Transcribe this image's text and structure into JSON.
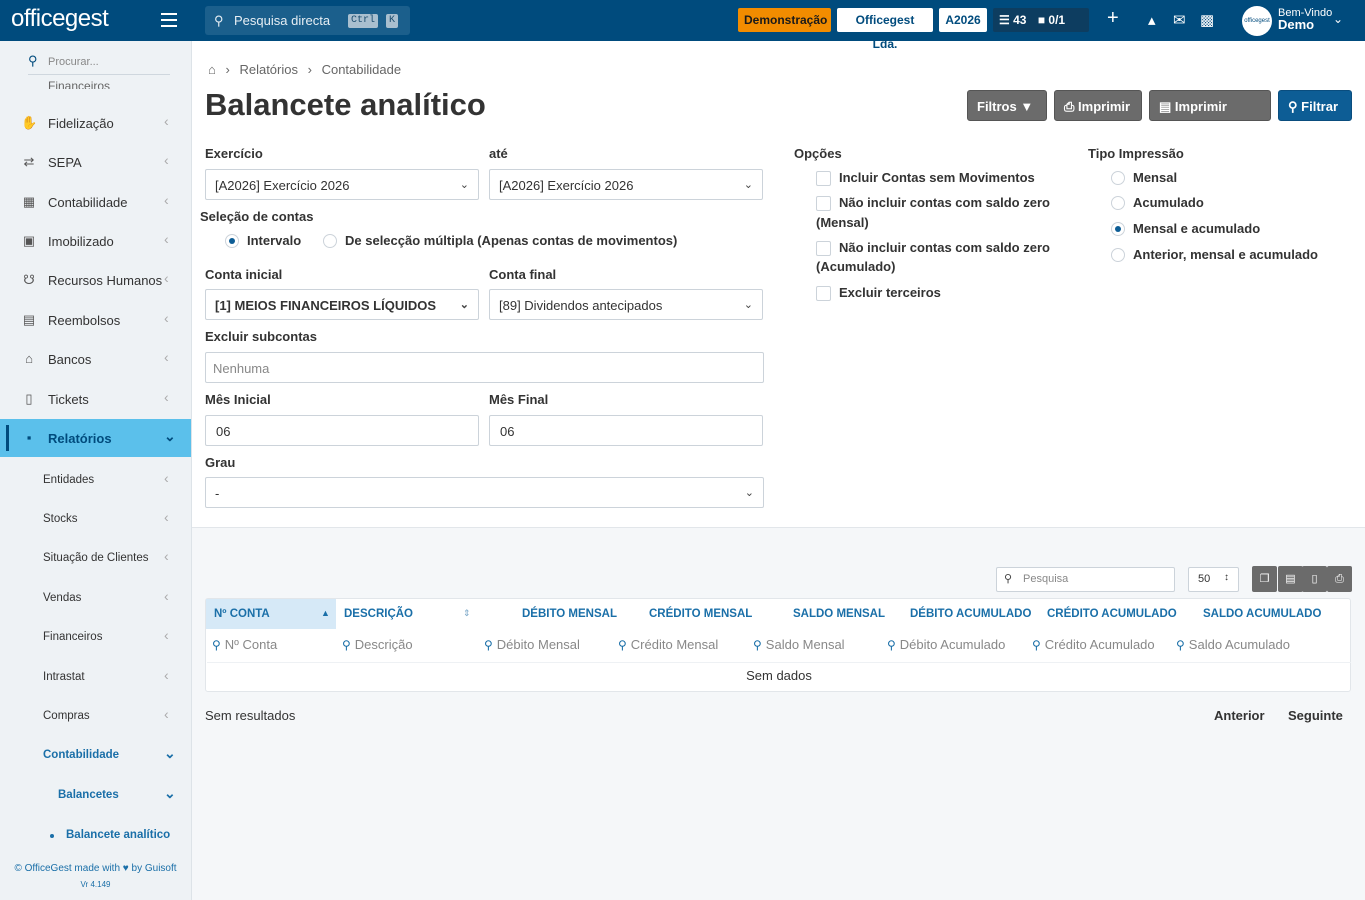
{
  "topbar": {
    "logo": "officegest",
    "search_placeholder": "Pesquisa directa",
    "kbd_ctrl": "Ctrl",
    "kbd_k": "K",
    "demo_badge": "Demonstração",
    "company_badge": "Officegest Lda.",
    "year_badge": "A2026",
    "tasks_count": "43",
    "docs_count": "0/1",
    "welcome": "Bem-Vindo",
    "user": "Demo",
    "avatar_text": "officegest",
    "colors": {
      "bar": "#004b7d",
      "demo": "#f28c00"
    }
  },
  "sidebar": {
    "search_placeholder": "Procurar...",
    "cut_item": "Financeiros",
    "items": [
      {
        "label": "Fidelização",
        "icon": "hand-coin-icon"
      },
      {
        "label": "SEPA",
        "icon": "arrows-swap-icon"
      },
      {
        "label": "Contabilidade",
        "icon": "calculator-icon"
      },
      {
        "label": "Imobilizado",
        "icon": "boxes-icon"
      },
      {
        "label": "Recursos Humanos",
        "icon": "org-chart-icon"
      },
      {
        "label": "Reembolsos",
        "icon": "money-icon"
      },
      {
        "label": "Bancos",
        "icon": "bank-icon"
      },
      {
        "label": "Tickets",
        "icon": "ticket-icon"
      },
      {
        "label": "Relatórios",
        "icon": "chart-icon"
      }
    ],
    "sub_items": [
      {
        "label": "Entidades"
      },
      {
        "label": "Stocks"
      },
      {
        "label": "Situação de Clientes"
      },
      {
        "label": "Vendas"
      },
      {
        "label": "Financeiros"
      },
      {
        "label": "Intrastat"
      },
      {
        "label": "Compras"
      },
      {
        "label": "Contabilidade"
      },
      {
        "label": "Balancetes"
      },
      {
        "label": "Balancete analítico"
      }
    ],
    "footer_a": "© OfficeGest made with",
    "footer_b": "by Guisoft",
    "version": "Vr 4.149",
    "active_color": "#5bc0eb"
  },
  "page": {
    "breadcrumb": [
      "Relatórios",
      "Contabilidade"
    ],
    "title": "Balancete analítico",
    "buttons": {
      "filters": "Filtros",
      "print": "Imprimir",
      "print_excel": "Imprimir Excel",
      "filter": "Filtrar"
    }
  },
  "form": {
    "exercicio_label": "Exercício",
    "exercicio_value": "[A2026] Exercício 2026",
    "ate_label": "até",
    "ate_value": "[A2026] Exercício 2026",
    "selecao_label": "Seleção de contas",
    "radio_intervalo": "Intervalo",
    "radio_multipla": "De selecção múltipla (Apenas contas de movimentos)",
    "conta_inicial_label": "Conta inicial",
    "conta_inicial_value": "[1] MEIOS FINANCEIROS LÍQUIDOS",
    "conta_final_label": "Conta final",
    "conta_final_value": "[89] Dividendos antecipados",
    "excluir_label": "Excluir subcontas",
    "excluir_placeholder": "Nenhuma",
    "mes_inicial_label": "Mês Inicial",
    "mes_inicial_value": "06",
    "mes_final_label": "Mês Final",
    "mes_final_value": "06",
    "grau_label": "Grau",
    "grau_value": "-",
    "opcoes_label": "Opções",
    "opt1": "Incluir Contas sem Movimentos",
    "opt2a": "Não incluir contas com saldo zero",
    "opt2b": "(Mensal)",
    "opt3a": "Não incluir contas com saldo zero",
    "opt3b": "(Acumulado)",
    "opt4": "Excluir terceiros",
    "tipo_label": "Tipo Impressão",
    "tipo1": "Mensal",
    "tipo2": "Acumulado",
    "tipo3": "Mensal e acumulado",
    "tipo4": "Anterior, mensal e acumulado"
  },
  "grid": {
    "search_placeholder": "Pesquisa",
    "page_size": "50",
    "columns": [
      "Nº CONTA",
      "DESCRIÇÃO",
      "DÉBITO MENSAL",
      "CRÉDITO MENSAL",
      "SALDO MENSAL",
      "DÉBITO ACUMULADO",
      "CRÉDITO ACUMULADO",
      "SALDO ACUMULADO"
    ],
    "filters": [
      "Nº Conta",
      "Descrição",
      "Débito Mensal",
      "Crédito Mensal",
      "Saldo Mensal",
      "Débito Acumulado",
      "Crédito Acumulado",
      "Saldo Acumulado"
    ],
    "empty": "Sem dados",
    "results": "Sem resultados",
    "prev": "Anterior",
    "next": "Seguinte"
  }
}
